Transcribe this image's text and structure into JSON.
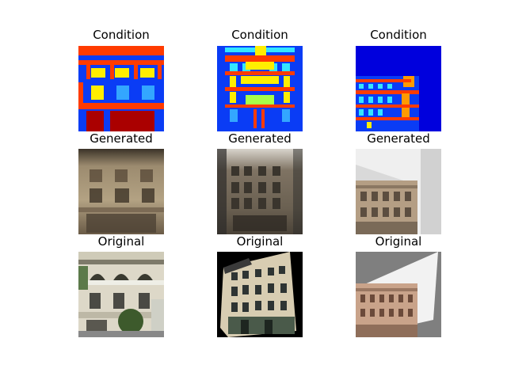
{
  "figure": {
    "rows": [
      {
        "row_label": "Condition",
        "titles": [
          "Condition",
          "Condition",
          "Condition"
        ]
      },
      {
        "row_label": "Generated",
        "titles": [
          "Generated",
          "Generated",
          "Generated"
        ]
      },
      {
        "row_label": "Original",
        "titles": [
          "Original",
          "Original",
          "Original"
        ]
      }
    ]
  },
  "colors": {
    "label_blue": "#0a3cf5",
    "label_red": "#ff3b00",
    "label_yellow": "#ffee00",
    "label_cyan": "#33e6ff",
    "label_darkred": "#aa0000",
    "label_green": "#a8ff48",
    "label_orange": "#ff9a00"
  }
}
